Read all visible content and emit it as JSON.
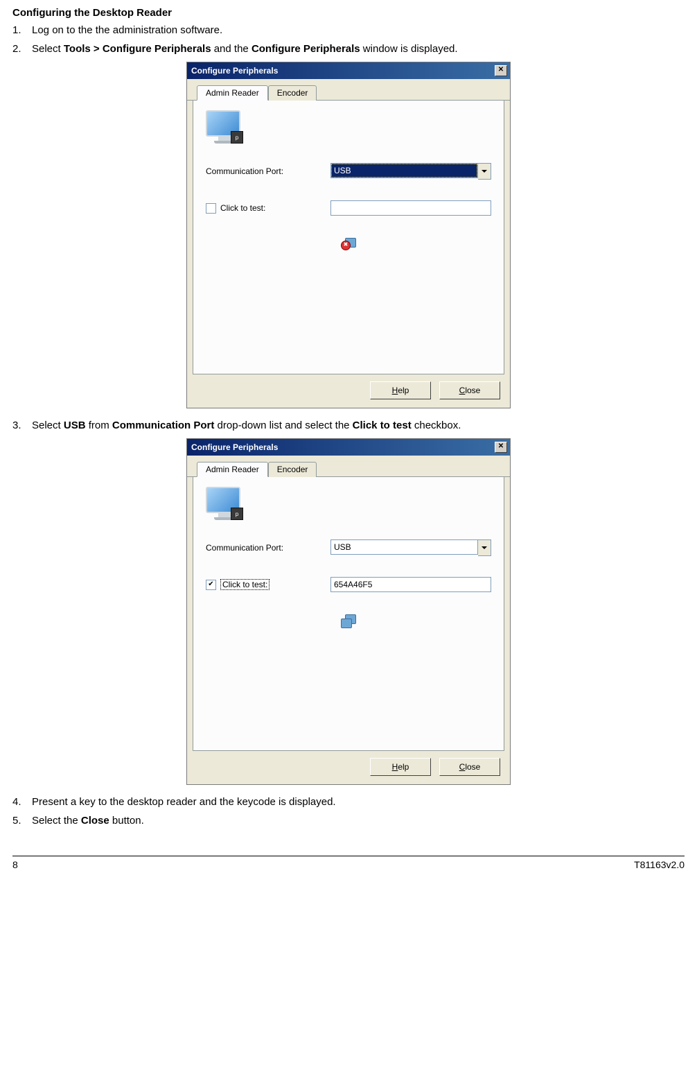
{
  "doc": {
    "heading": "Configuring the Desktop Reader",
    "steps": {
      "s1": {
        "n": "1.",
        "text": "Log on to the the administration software."
      },
      "s2": {
        "n": "2.",
        "pre": "Select ",
        "b1": "Tools > Configure Peripherals",
        "mid": " and the ",
        "b2": "Configure Peripherals",
        "post": " window is displayed."
      },
      "s3": {
        "n": "3.",
        "pre": "Select ",
        "b1": "USB",
        "mid1": " from ",
        "b2": "Communication Port",
        "mid2": " drop-down list and select the ",
        "b3": "Click to test",
        "post": " checkbox."
      },
      "s4": {
        "n": "4.",
        "text": "Present a key to the desktop reader and the keycode is displayed."
      },
      "s5": {
        "n": "5.",
        "pre": "Select the ",
        "b1": "Close",
        "post": " button."
      }
    },
    "footer": {
      "page": "8",
      "docid": "T81163v2.0"
    }
  },
  "win1": {
    "title": "Configure Peripherals",
    "tabs": {
      "active": "Admin Reader",
      "inactive": "Encoder"
    },
    "commport_label": "Communication Port:",
    "commport_value": "USB",
    "clicktest_label": "Click to test:",
    "test_value": "",
    "help": "Help",
    "close": "Close"
  },
  "win2": {
    "title": "Configure Peripherals",
    "tabs": {
      "active": "Admin Reader",
      "inactive": "Encoder"
    },
    "commport_label": "Communication Port:",
    "commport_value": "USB",
    "clicktest_label": "Click to test:",
    "test_value": "654A46F5",
    "help": "Help",
    "close": "Close"
  }
}
